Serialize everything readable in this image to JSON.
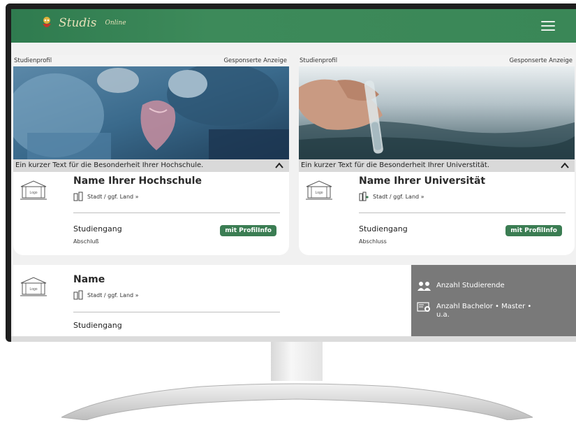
{
  "header": {
    "logo_text": "Studis",
    "logo_sub": "Online",
    "menu_icon": "hamburger-icon"
  },
  "cards": [
    {
      "profile_label": "Studienprofil",
      "ad_label": "Gesponserte Anzeige",
      "photo": "surgery-heart-photo",
      "caption": "Ein kurzer Text für die Besonderheit Ihrer Hochschule.",
      "logo_label": "Logo",
      "name": "Name Ihrer Hochschule",
      "location": "Stadt / ggf. Land »",
      "course": "Studiengang",
      "degree": "Abschluß",
      "badge": "mit ProfilInfo"
    },
    {
      "profile_label": "Studienprofil",
      "ad_label": "Gesponserte Anzeige",
      "photo": "water-sample-tube-photo",
      "caption": "Ein kurzer Text für die Besonderheit Ihrer Universtität.",
      "logo_label": "Logo",
      "name": "Name Ihrer Universität",
      "location": "Stadt / ggf. Land »",
      "course": "Studiengang",
      "degree": "Abschluss",
      "badge": "mit ProfilInfo"
    }
  ],
  "card3": {
    "logo_label": "Logo",
    "name": "Name",
    "location": "Stadt / ggf. Land »",
    "course": "Studiengang"
  },
  "stats": {
    "students": "Anzahl Studierende",
    "degrees": "Anzahl Bachelor • Master • u.a."
  },
  "colors": {
    "header_green": "#3a8757",
    "badge_green": "#3b7d53",
    "stats_gray": "#797979"
  }
}
